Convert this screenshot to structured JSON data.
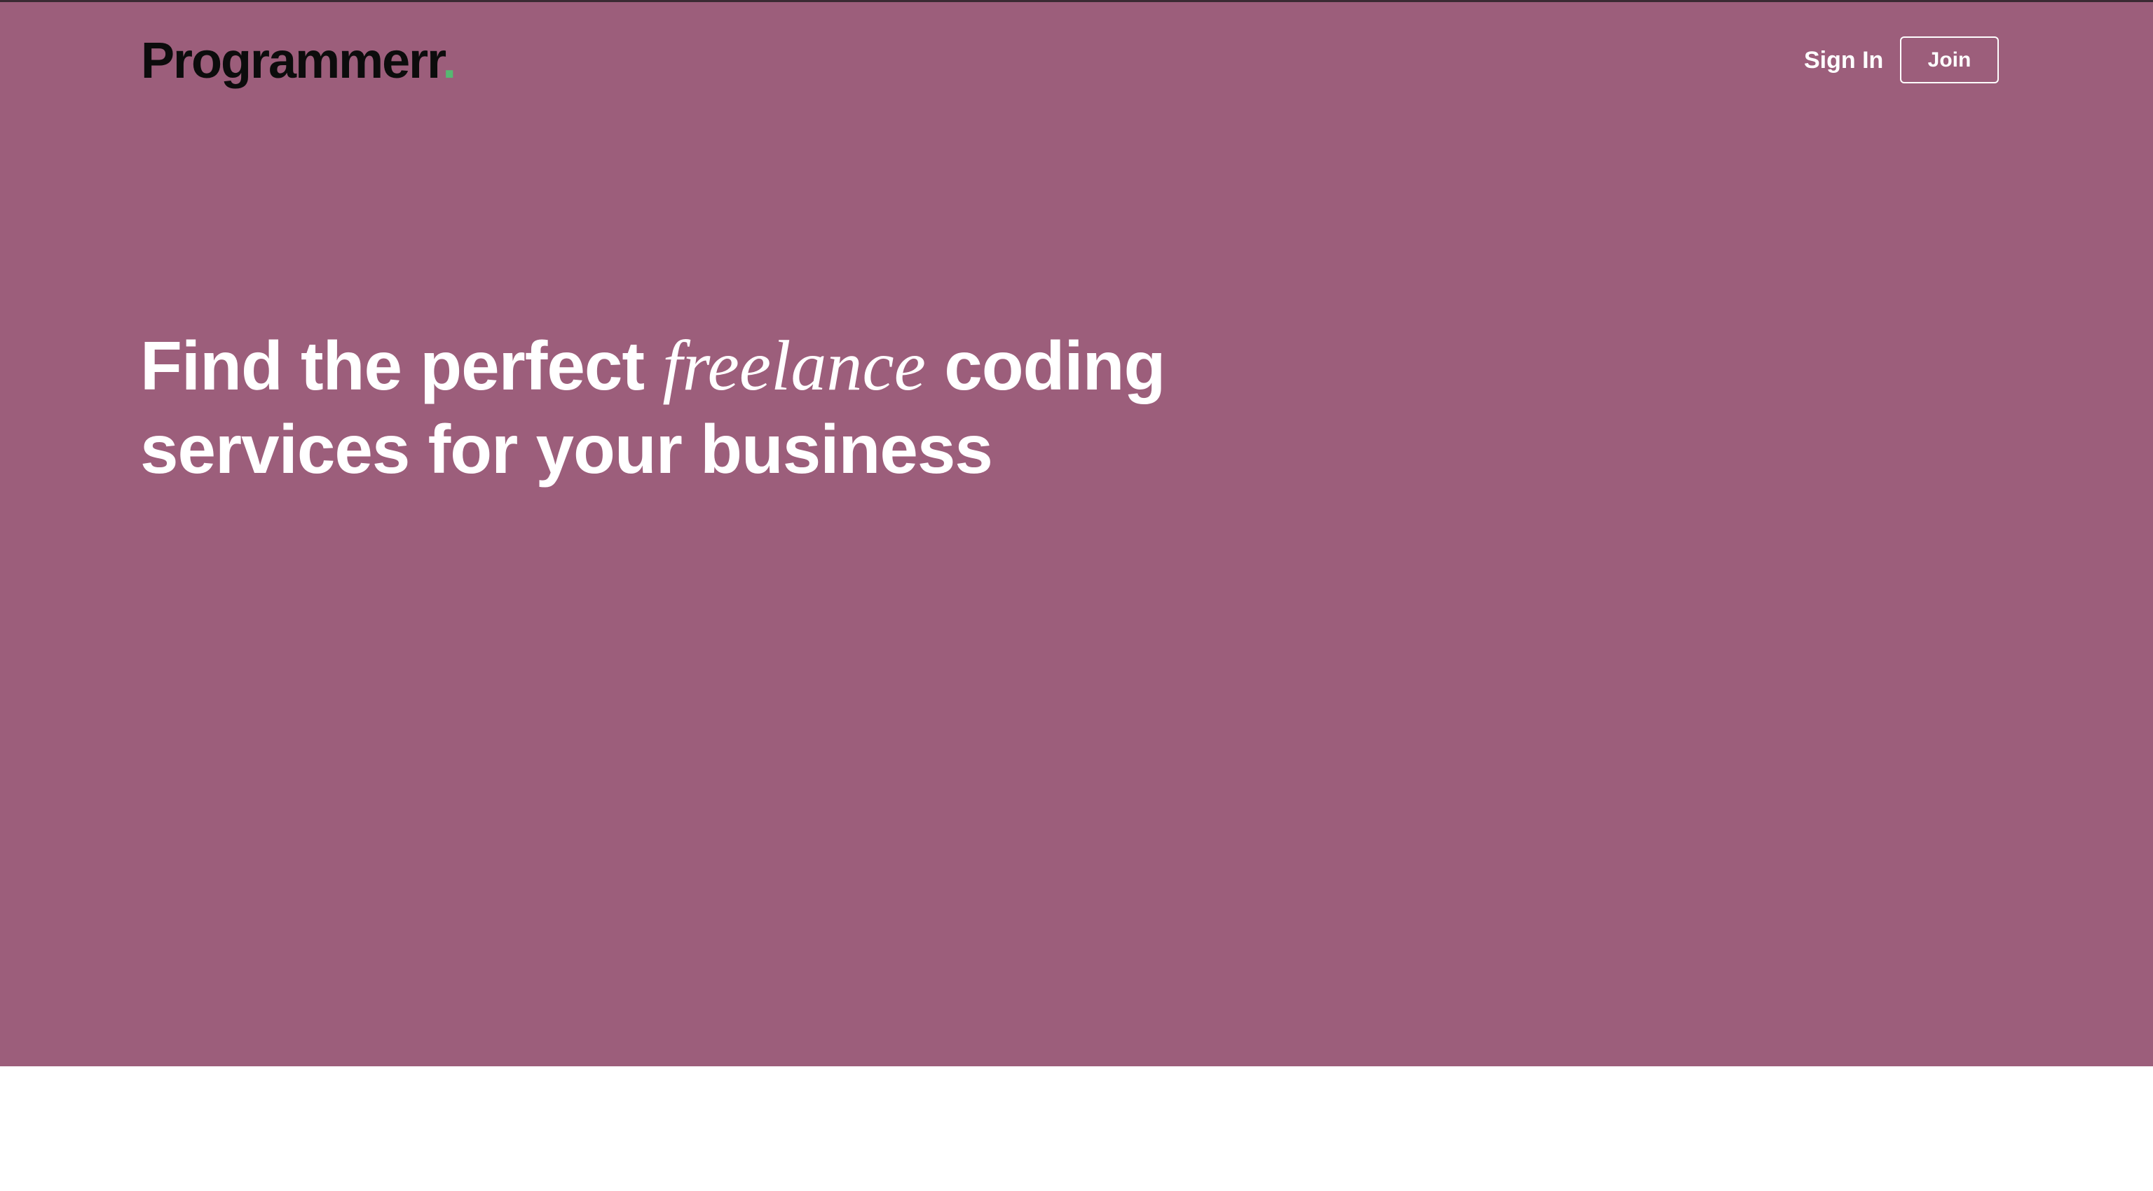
{
  "header": {
    "logo_text": "Programmerr",
    "logo_dot": ".",
    "signin_label": "Sign In",
    "join_label": "Join"
  },
  "hero": {
    "headline_part1": "Find the perfect ",
    "headline_emphasis": "freelance",
    "headline_part2": " coding",
    "headline_line2": "services for your business"
  },
  "colors": {
    "hero_background": "#9c5e7b",
    "logo_text": "#0c0c0c",
    "logo_dot": "#56b872",
    "page_background": "#ffffff",
    "text_on_hero": "#ffffff"
  }
}
